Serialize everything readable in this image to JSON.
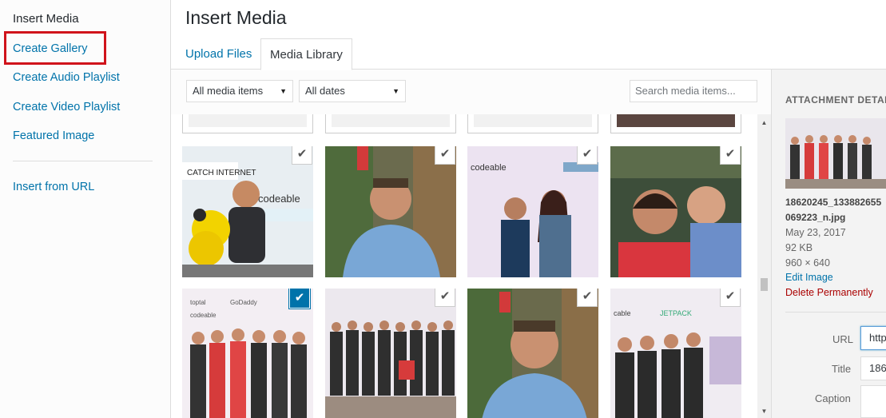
{
  "sidebar": {
    "title": "Insert Media",
    "items": [
      {
        "label": "Create Gallery"
      },
      {
        "label": "Create Audio Playlist"
      },
      {
        "label": "Create Video Playlist"
      },
      {
        "label": "Featured Image"
      },
      {
        "label": "Insert from URL"
      }
    ]
  },
  "header": {
    "title": "Insert Media",
    "tabs": [
      {
        "label": "Upload Files",
        "active": false
      },
      {
        "label": "Media Library",
        "active": true
      }
    ]
  },
  "toolbar": {
    "type_filter": "All media items",
    "date_filter": "All dates",
    "search_placeholder": "Search media items..."
  },
  "grid": {
    "items": [
      {
        "kind": "photo",
        "subject": "man with yellow teddy bear at Catch Internet banner",
        "checked": true,
        "selected": false
      },
      {
        "kind": "photo",
        "subject": "man in blue shirt smiling",
        "checked": true,
        "selected": false
      },
      {
        "kind": "photo",
        "subject": "two women at codeable backdrop",
        "checked": true,
        "selected": false
      },
      {
        "kind": "photo",
        "subject": "face painting at event",
        "checked": true,
        "selected": false
      },
      {
        "kind": "photo",
        "subject": "group photo of men in front of sponsor wall",
        "checked": true,
        "selected": true
      },
      {
        "kind": "photo",
        "subject": "large group at sponsor wall",
        "checked": true,
        "selected": false
      },
      {
        "kind": "photo",
        "subject": "man in blue shirt close-up",
        "checked": true,
        "selected": false
      },
      {
        "kind": "photo",
        "subject": "men at Jetpack backdrop",
        "checked": true,
        "selected": false
      }
    ],
    "check_glyph": "✔",
    "accent_color": "#0073aa"
  },
  "details": {
    "heading": "ATTACHMENT DETAILS",
    "filename_line1": "18620245_133882655",
    "filename_line2": "069223_n.jpg",
    "date": "May 23, 2017",
    "size": "92 KB",
    "dimensions": "960 × 640",
    "edit_link": "Edit Image",
    "delete_link": "Delete Permanently",
    "fields": [
      {
        "label": "URL",
        "value": "http"
      },
      {
        "label": "Title",
        "value": "186"
      },
      {
        "label": "Caption",
        "value": ""
      }
    ]
  }
}
